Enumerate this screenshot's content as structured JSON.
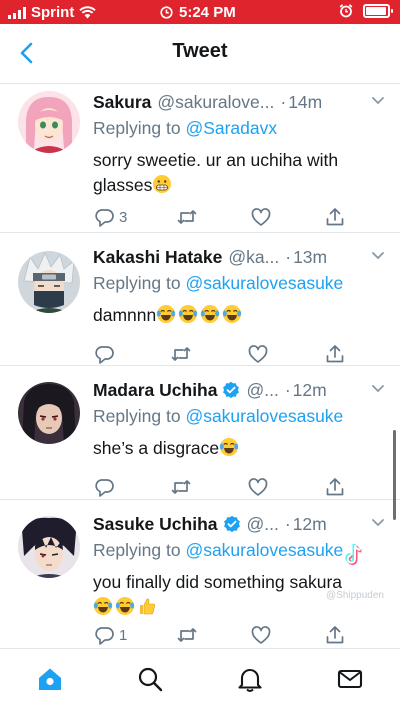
{
  "status_bar": {
    "carrier": "Sprint",
    "time": "5:24 PM"
  },
  "header": {
    "title": "Tweet"
  },
  "tweets": [
    {
      "name": "Sakura",
      "handle": "@sakuralove...",
      "dot": "·",
      "time": "14m",
      "verified": false,
      "replying_label": "Replying to",
      "replying_to": "@Saradavx",
      "lines": [
        "sorry sweetie. ur an uchiha with",
        "glasses"
      ],
      "emojis": [
        "grimacing-face"
      ],
      "reply_count": "3",
      "retweet_count": "",
      "like_count": ""
    },
    {
      "name": "Kakashi Hatake",
      "handle": "@ka...",
      "dot": "·",
      "time": "13m",
      "verified": false,
      "replying_label": "Replying to",
      "replying_to": "@sakuralovesasuke",
      "lines": [
        "damnnn"
      ],
      "emojis": [
        "laughing-crying-face",
        "laughing-crying-face",
        "laughing-crying-face",
        "laughing-crying-face"
      ],
      "reply_count": "",
      "retweet_count": "",
      "like_count": ""
    },
    {
      "name": "Madara Uchiha",
      "handle": "@...",
      "dot": "·",
      "time": "12m",
      "verified": true,
      "replying_label": "Replying to",
      "replying_to": "@sakuralovesasuke",
      "lines": [
        "she’s a disgrace"
      ],
      "emojis": [
        "laughing-crying-face"
      ],
      "reply_count": "",
      "retweet_count": "",
      "like_count": ""
    },
    {
      "name": "Sasuke Uchiha",
      "handle": "@...",
      "dot": "·",
      "time": "12m",
      "verified": true,
      "replying_label": "Replying to",
      "replying_to": "@sakuralovesasuke",
      "lines": [
        "you finally did something sakura"
      ],
      "emojis": [
        "laughing-crying-face",
        "laughing-crying-face",
        "thumbs-up"
      ],
      "reply_count": "1",
      "retweet_count": "",
      "like_count": ""
    }
  ],
  "watermark": {
    "app": "TikTok",
    "username": "@Shippuden"
  },
  "tab_bar": {
    "items": [
      "home-icon",
      "search-icon",
      "notifications-icon",
      "messages-icon"
    ],
    "active": "home-icon"
  },
  "colors": {
    "status_bar": "#e0242d",
    "accent": "#1da1f2",
    "secondary_text": "#657786"
  }
}
